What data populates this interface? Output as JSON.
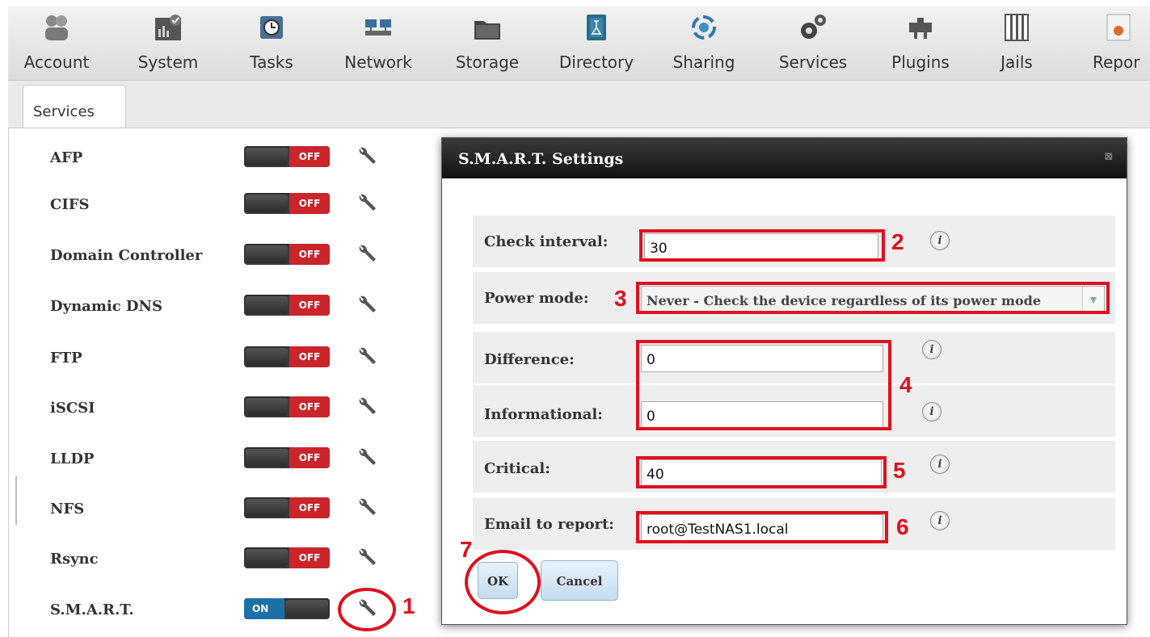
{
  "toolbar": {
    "items": [
      {
        "label": "Account",
        "icon": "account-icon"
      },
      {
        "label": "System",
        "icon": "system-icon"
      },
      {
        "label": "Tasks",
        "icon": "tasks-icon"
      },
      {
        "label": "Network",
        "icon": "network-icon"
      },
      {
        "label": "Storage",
        "icon": "storage-icon"
      },
      {
        "label": "Directory",
        "icon": "directory-icon"
      },
      {
        "label": "Sharing",
        "icon": "sharing-icon"
      },
      {
        "label": "Services",
        "icon": "services-icon"
      },
      {
        "label": "Plugins",
        "icon": "plugins-icon"
      },
      {
        "label": "Jails",
        "icon": "jails-icon"
      },
      {
        "label": "Repor",
        "icon": "reporting-icon"
      }
    ]
  },
  "tab": {
    "label": "Services"
  },
  "services": [
    {
      "name": "AFP",
      "state": "OFF"
    },
    {
      "name": "CIFS",
      "state": "OFF"
    },
    {
      "name": "Domain Controller",
      "state": "OFF"
    },
    {
      "name": "Dynamic DNS",
      "state": "OFF"
    },
    {
      "name": "FTP",
      "state": "OFF"
    },
    {
      "name": "iSCSI",
      "state": "OFF"
    },
    {
      "name": "LLDP",
      "state": "OFF"
    },
    {
      "name": "NFS",
      "state": "OFF"
    },
    {
      "name": "Rsync",
      "state": "OFF"
    },
    {
      "name": "S.M.A.R.T.",
      "state": "ON"
    }
  ],
  "dialog": {
    "title": "S.M.A.R.T. Settings",
    "close_glyph": "⊠",
    "fields": {
      "check_interval": {
        "label": "Check interval:",
        "value": "30"
      },
      "power_mode": {
        "label": "Power mode:",
        "value": "Never - Check the device regardless of its power mode"
      },
      "difference": {
        "label": "Difference:",
        "value": "0"
      },
      "informational": {
        "label": "Informational:",
        "value": "0"
      },
      "critical": {
        "label": "Critical:",
        "value": "40"
      },
      "email": {
        "label": "Email to report:",
        "value": "root@TestNAS1.local"
      }
    },
    "ok_label": "OK",
    "cancel_label": "Cancel",
    "info_glyph": "i"
  },
  "annotations": [
    "1",
    "2",
    "3",
    "4",
    "5",
    "6",
    "7"
  ],
  "colors": {
    "annotation_red": "#e0101e",
    "off_red": "#c9252b",
    "on_blue": "#1d6fa8",
    "title_bar": "#1a1a1a"
  }
}
